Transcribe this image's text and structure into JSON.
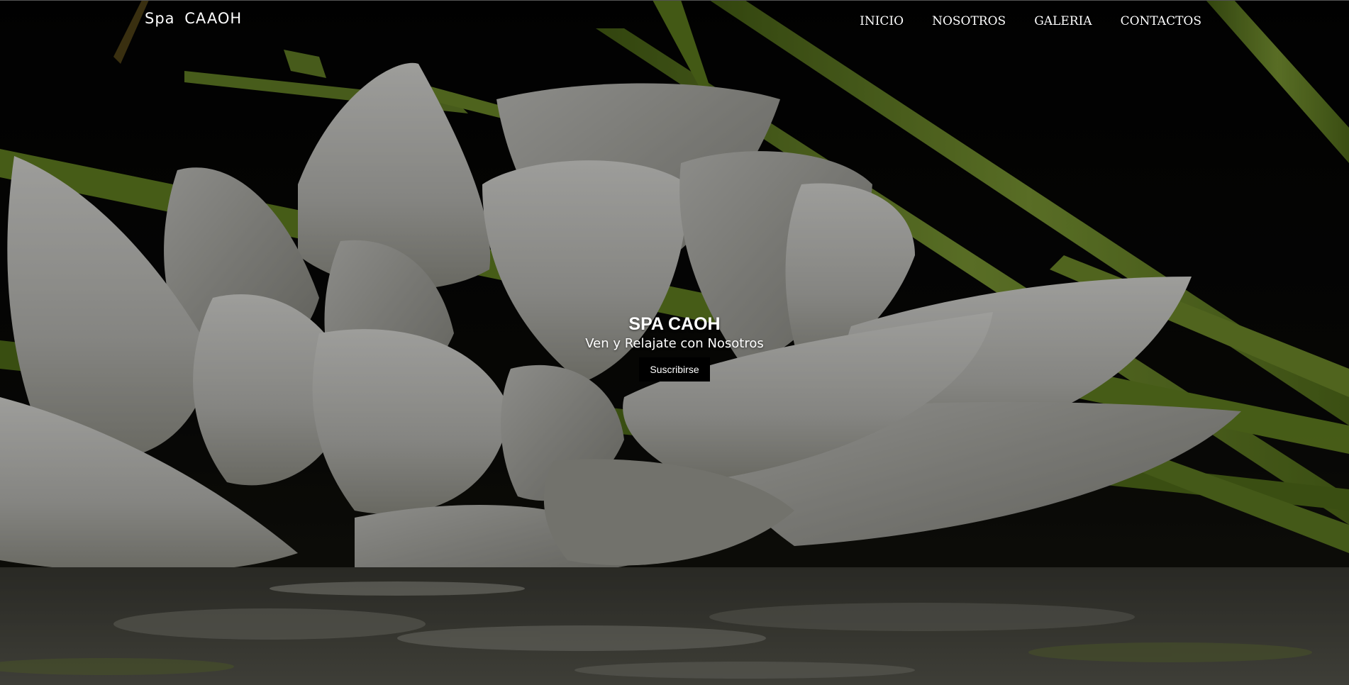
{
  "header": {
    "brand": "Spa  CAAOH",
    "nav": [
      "INICIO",
      "NOSOTROS",
      "GALERIA",
      "CONTACTOS"
    ]
  },
  "hero": {
    "title": "SPA CAOH",
    "subtitle": "Ven y Relajate con Nosotros",
    "cta_label": "Suscribirse",
    "background_image": "white-lotus-flower-with-green-leaves-and-water-reflection"
  },
  "colors": {
    "text": "#ffffff",
    "button_bg": "#000000",
    "leaf_green": "#7a9a2e",
    "petal_white": "#d8d8d2"
  }
}
